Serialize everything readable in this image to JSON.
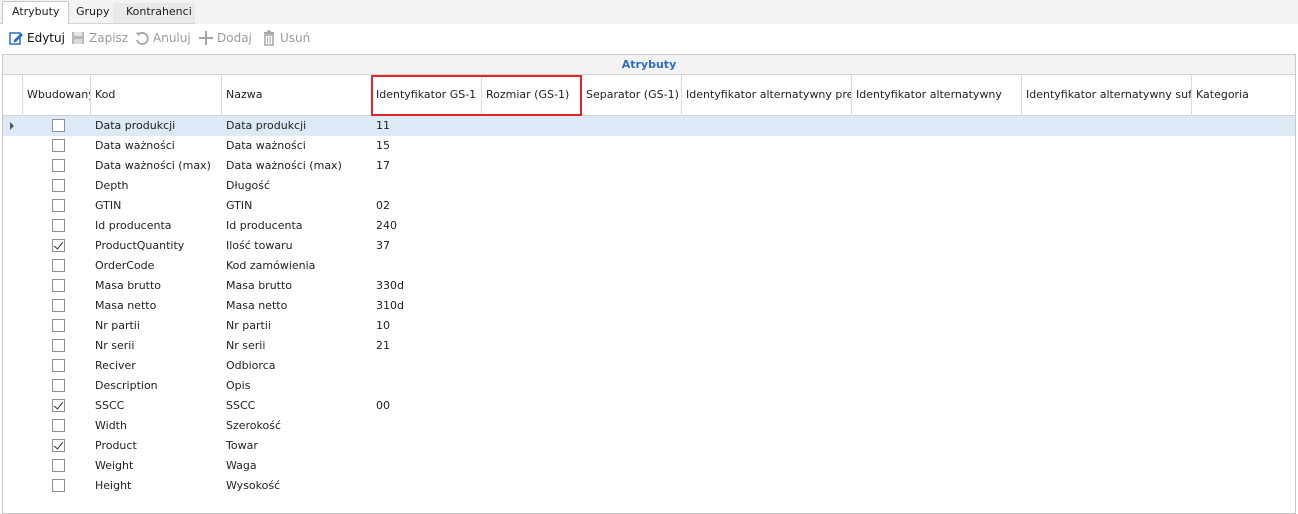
{
  "tabs": [
    {
      "label": "Atrybuty",
      "active": true
    },
    {
      "label": "Grupy",
      "active": false
    },
    {
      "label": "Kontrahenci",
      "active": false
    }
  ],
  "toolbar": {
    "edit": {
      "label": "Edytuj",
      "icon": "edit-icon",
      "enabled": true
    },
    "save": {
      "label": "Zapisz",
      "icon": "save-icon",
      "enabled": false
    },
    "cancel": {
      "label": "Anuluj",
      "icon": "undo-icon",
      "enabled": false
    },
    "add": {
      "label": "Dodaj",
      "icon": "plus-icon",
      "enabled": false
    },
    "delete": {
      "label": "Usuń",
      "icon": "trash-icon",
      "enabled": false
    }
  },
  "grid": {
    "band_title": "Atrybuty",
    "band_color": "#2b6cc4",
    "highlight_color": "#e0262a",
    "selected_row_color": "#dde9f6",
    "columns": [
      "Wbudowany",
      "Kod",
      "Nazwa",
      "Identyfikator GS-1",
      "Rozmiar (GS-1)",
      "Separator (GS-1)",
      "Identyfikator alternatywny prefix",
      "Identyfikator alternatywny",
      "Identyfikator alternatywny suffix",
      "Kategoria"
    ],
    "rows": [
      {
        "builtin": false,
        "kod": "Data produkcji",
        "nazwa": "Data produkcji",
        "gs1": "11"
      },
      {
        "builtin": false,
        "kod": "Data ważności",
        "nazwa": "Data ważności",
        "gs1": "15"
      },
      {
        "builtin": false,
        "kod": "Data ważności (max)",
        "nazwa": "Data ważności (max)",
        "gs1": "17"
      },
      {
        "builtin": false,
        "kod": "Depth",
        "nazwa": "Długość",
        "gs1": ""
      },
      {
        "builtin": false,
        "kod": "GTIN",
        "nazwa": "GTIN",
        "gs1": "02"
      },
      {
        "builtin": false,
        "kod": "Id producenta",
        "nazwa": "Id producenta",
        "gs1": "240"
      },
      {
        "builtin": true,
        "kod": "ProductQuantity",
        "nazwa": "Ilość towaru",
        "gs1": "37"
      },
      {
        "builtin": false,
        "kod": "OrderCode",
        "nazwa": "Kod zamówienia",
        "gs1": ""
      },
      {
        "builtin": false,
        "kod": "Masa brutto",
        "nazwa": "Masa brutto",
        "gs1": "330d"
      },
      {
        "builtin": false,
        "kod": "Masa netto",
        "nazwa": "Masa netto",
        "gs1": "310d"
      },
      {
        "builtin": false,
        "kod": "Nr partii",
        "nazwa": "Nr partii",
        "gs1": "10"
      },
      {
        "builtin": false,
        "kod": "Nr serii",
        "nazwa": "Nr serii",
        "gs1": "21"
      },
      {
        "builtin": false,
        "kod": "Reciver",
        "nazwa": "Odbiorca",
        "gs1": ""
      },
      {
        "builtin": false,
        "kod": "Description",
        "nazwa": "Opis",
        "gs1": ""
      },
      {
        "builtin": true,
        "kod": "SSCC",
        "nazwa": "SSCC",
        "gs1": "00"
      },
      {
        "builtin": false,
        "kod": "Width",
        "nazwa": "Szerokość",
        "gs1": ""
      },
      {
        "builtin": true,
        "kod": "Product",
        "nazwa": "Towar",
        "gs1": ""
      },
      {
        "builtin": false,
        "kod": "Weight",
        "nazwa": "Waga",
        "gs1": ""
      },
      {
        "builtin": false,
        "kod": "Height",
        "nazwa": "Wysokość",
        "gs1": ""
      }
    ]
  }
}
